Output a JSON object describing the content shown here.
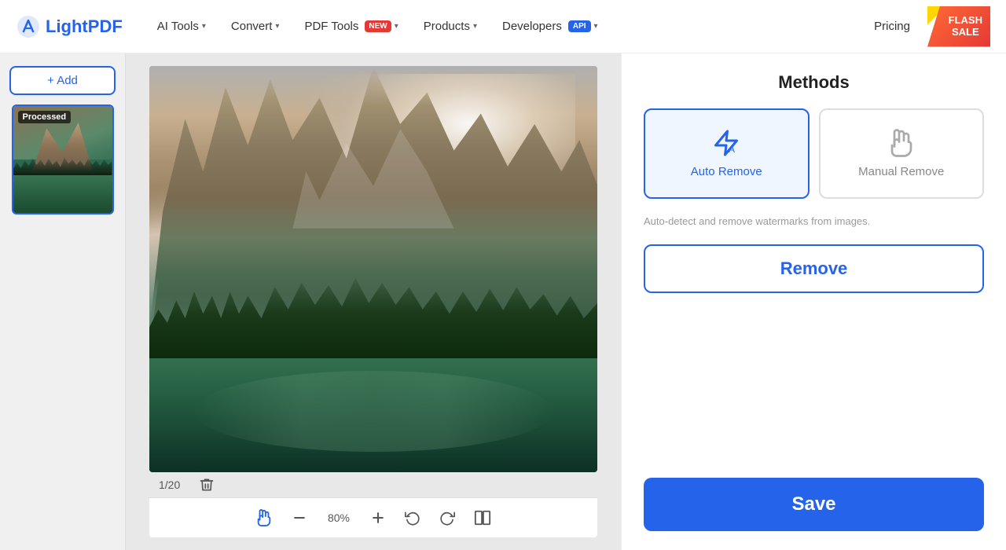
{
  "header": {
    "logo_text_light": "Light",
    "logo_text_bold": "PDF",
    "nav": [
      {
        "id": "ai-tools",
        "label": "AI Tools",
        "has_chevron": true,
        "badge": null
      },
      {
        "id": "convert",
        "label": "Convert",
        "has_chevron": true,
        "badge": null
      },
      {
        "id": "pdf-tools",
        "label": "PDF Tools",
        "has_chevron": true,
        "badge": "NEW"
      },
      {
        "id": "products",
        "label": "Products",
        "has_chevron": true,
        "badge": null
      },
      {
        "id": "developers",
        "label": "Developers",
        "has_chevron": true,
        "badge": "API"
      },
      {
        "id": "pricing",
        "label": "Pricing",
        "has_chevron": false,
        "badge": null
      }
    ],
    "flash_sale_line1": "FLASH",
    "flash_sale_line2": "SALE"
  },
  "sidebar": {
    "add_button_label": "+ Add",
    "thumbnail_badge": "Processed",
    "page_counter": "1/20"
  },
  "toolbar": {
    "zoom_level": "80%"
  },
  "panel": {
    "title": "Methods",
    "auto_remove_label": "Auto Remove",
    "manual_remove_label": "Manual Remove",
    "description": "Auto-detect and remove watermarks from images.",
    "remove_button_label": "Remove",
    "save_button_label": "Save"
  }
}
